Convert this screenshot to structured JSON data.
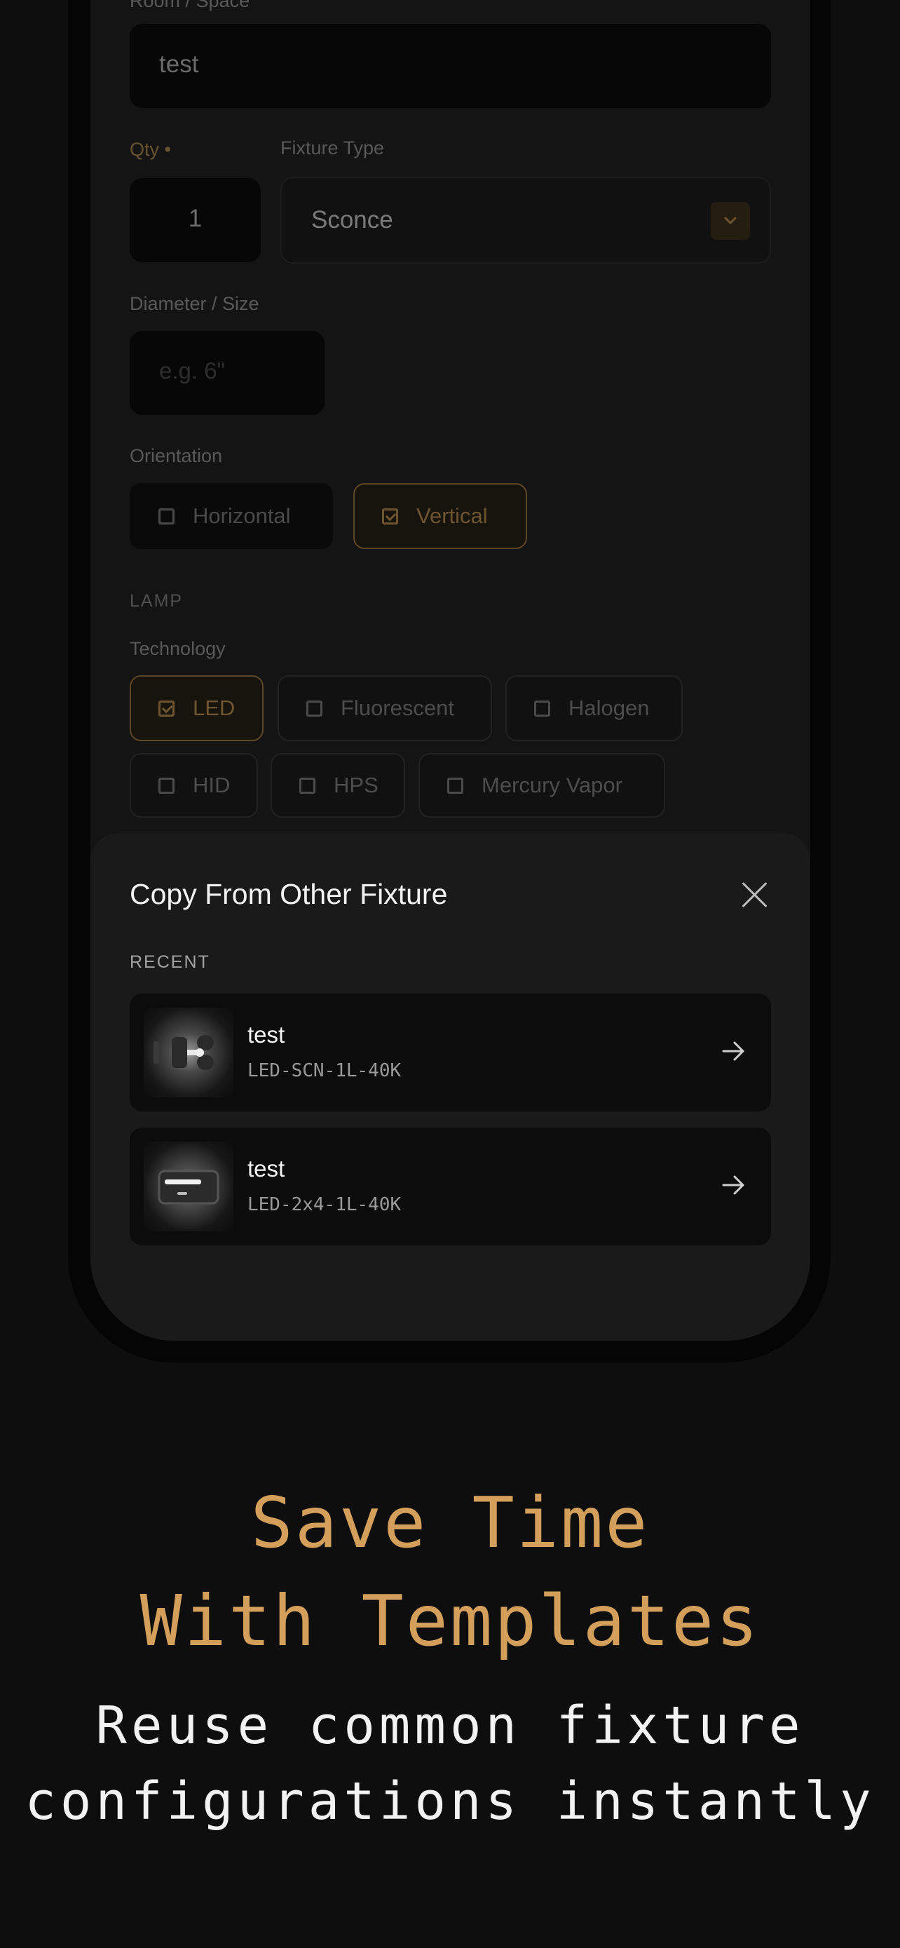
{
  "form": {
    "room_label": "Room / Space",
    "room_value": "test",
    "qty_label": "Qty •",
    "qty_value": "1",
    "fixture_type_label": "Fixture Type",
    "fixture_type_value": "Sconce",
    "diameter_label": "Diameter / Size",
    "diameter_placeholder": "e.g. 6\"",
    "orientation_label": "Orientation",
    "orientation_options": [
      {
        "label": "Horizontal",
        "selected": false
      },
      {
        "label": "Vertical",
        "selected": true
      }
    ],
    "lamp_section": "LAMP",
    "technology_label": "Technology",
    "technology_options": [
      {
        "label": "LED",
        "selected": true
      },
      {
        "label": "Fluorescent",
        "selected": false
      },
      {
        "label": "Halogen",
        "selected": false
      },
      {
        "label": "HID",
        "selected": false
      },
      {
        "label": "HPS",
        "selected": false
      },
      {
        "label": "Mercury Vapor",
        "selected": false
      }
    ]
  },
  "sheet": {
    "title": "Copy From Other Fixture",
    "recent_label": "RECENT",
    "items": [
      {
        "name": "test",
        "code": "LED-SCN-1L-40K",
        "icon": "sconce-icon"
      },
      {
        "name": "test",
        "code": "LED-2x4-1L-40K",
        "icon": "troffer-icon"
      }
    ]
  },
  "marketing": {
    "headline_line1": "Save Time",
    "headline_line2": "With Templates",
    "subline_line1": "Reuse common fixture",
    "subline_line2": "configurations instantly"
  },
  "colors": {
    "accent": "#d39f5a",
    "background": "#0e0e0e",
    "sheet": "#1a1a1a"
  }
}
